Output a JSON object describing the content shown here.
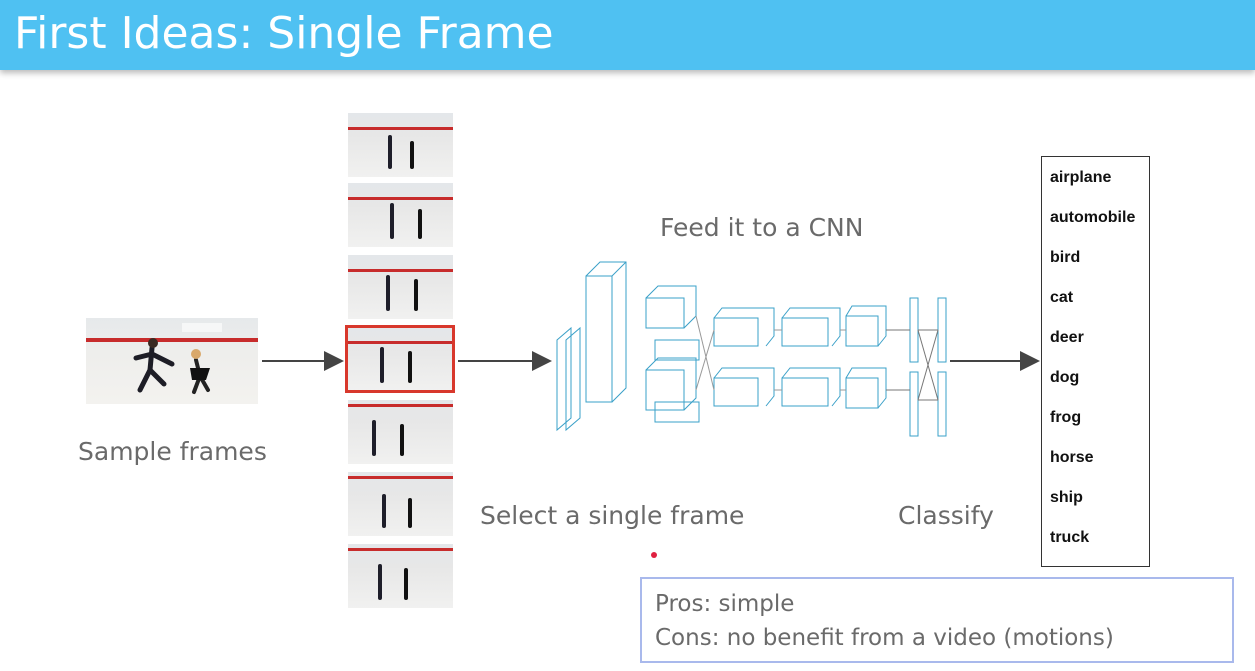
{
  "title": "First Ideas: Single Frame",
  "captions": {
    "sample_frames": "Sample frames",
    "feed_cnn": "Feed it to a CNN",
    "select_frame": "Select a single frame",
    "classify": "Classify"
  },
  "classes": [
    "airplane",
    "automobile",
    "bird",
    "cat",
    "deer",
    "dog",
    "frog",
    "horse",
    "ship",
    "truck"
  ],
  "pros": "Pros: simple",
  "cons": "Cons: no benefit from a video (motions)",
  "colors": {
    "header": "#4fc1f2",
    "selection": "#d8382c",
    "cnn": "#3aa0c8",
    "box_border": "#a9b9ec"
  }
}
